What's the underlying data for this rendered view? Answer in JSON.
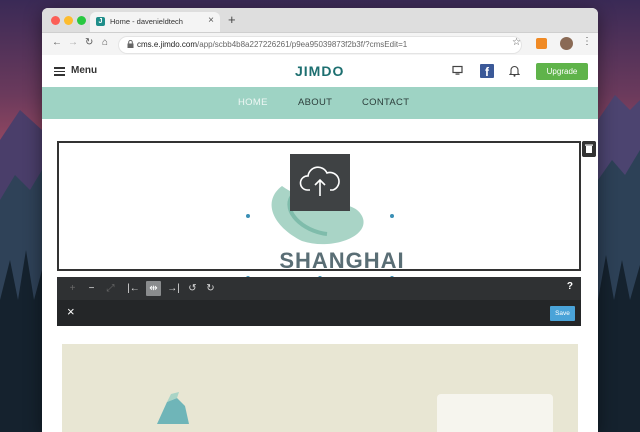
{
  "browser": {
    "tab_title": "Home - davenieldtech",
    "tab_favicon": "J",
    "url_host": "cms.e.jimdo.com",
    "url_path": "/app/scbb4b8a227226261/p9ea95039873f2b3f/?cmsEdit=1"
  },
  "site_header": {
    "menu_label": "Menu",
    "logo_text": "JIMDO",
    "upgrade_label": "Upgrade",
    "fb_letter": "f"
  },
  "nav": {
    "items": [
      "HOME",
      "ABOUT",
      "CONTACT"
    ],
    "active": "HOME"
  },
  "image_block": {
    "headline": "SHANGHAI"
  },
  "image_toolbar": {
    "help_label": "?"
  },
  "action_bar": {
    "save_label": "Save"
  },
  "colors": {
    "nav_bg": "#9ed3c4",
    "logo": "#1d6f70",
    "upgrade": "#5fb34a",
    "save": "#4aa3d8",
    "facebook": "#3b5998"
  }
}
